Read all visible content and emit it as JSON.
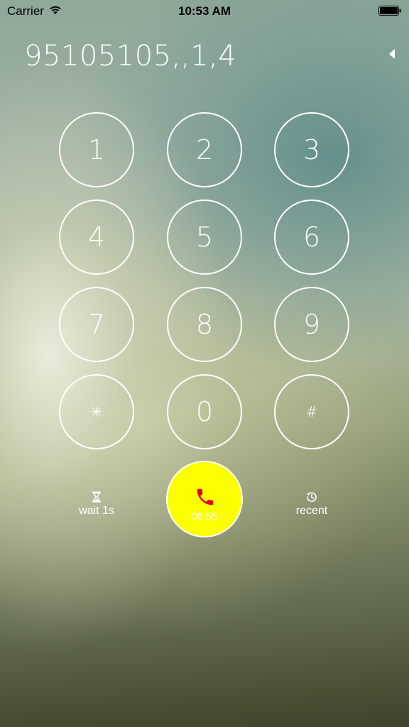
{
  "status_bar": {
    "carrier": "Carrier",
    "time": "10:53 AM",
    "wifi_icon": "wifi-icon",
    "battery_icon": "battery-icon"
  },
  "dialer": {
    "number": "95105105,,1,4",
    "backspace_icon": "backspace-icon",
    "keys": [
      "1",
      "2",
      "3",
      "4",
      "5",
      "6",
      "7",
      "8",
      "9",
      "✳",
      "0",
      "#"
    ]
  },
  "actions": {
    "wait": {
      "icon": "hourglass-icon",
      "label": "wait 1s"
    },
    "call": {
      "icon": "phone-icon",
      "timer": "06:55",
      "color": "#fbff00",
      "icon_color": "#e8001a"
    },
    "recent": {
      "icon": "history-icon",
      "label": "recent"
    }
  }
}
